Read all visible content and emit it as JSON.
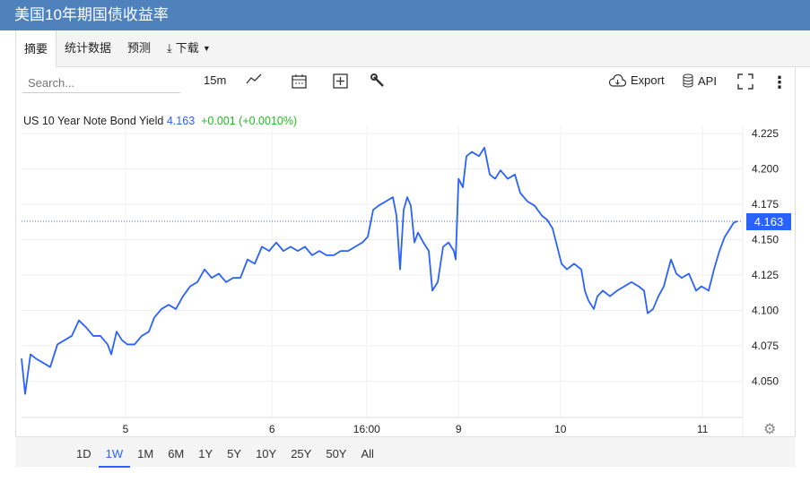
{
  "header": {
    "title": "美国10年期国债收益率"
  },
  "tabs": [
    {
      "label": "摘要"
    },
    {
      "label": "统计数据"
    },
    {
      "label": "预测"
    },
    {
      "label": "下载"
    }
  ],
  "toolbar": {
    "search_placeholder": "Search...",
    "interval": "15m",
    "export_label": "Export",
    "api_label": "API"
  },
  "legend": {
    "name": "US 10 Year Note Bond Yield",
    "value": "4.163",
    "change": "+0.001",
    "change_pct": "(+0.0010%)"
  },
  "ranges": [
    "1D",
    "1W",
    "1M",
    "6M",
    "1Y",
    "5Y",
    "10Y",
    "25Y",
    "50Y",
    "All"
  ],
  "active_range": "1W",
  "colors": {
    "header": "#4f81bd",
    "line": "#2962ff",
    "positive": "#22bb22"
  },
  "chart_data": {
    "type": "line",
    "title": "US 10 Year Note Bond Yield",
    "ylim": [
      4.025,
      4.24
    ],
    "xlim": [
      0,
      100.5
    ],
    "yticks": [
      4.05,
      4.075,
      4.1,
      4.125,
      4.15,
      4.175,
      4.2,
      4.225
    ],
    "ytick_labels": [
      "4.050",
      "4.075",
      "4.100",
      "4.125",
      "4.150",
      "4.175",
      "4.200",
      "4.225"
    ],
    "xticks": [
      14.5,
      34.9,
      48.1,
      60.9,
      75.1,
      94.9
    ],
    "xtick_labels": [
      "5",
      "6",
      "16:00",
      "9",
      "10",
      "11"
    ],
    "last_value": 4.163,
    "last_label": "4.163",
    "x": [
      0,
      0.5,
      1.25,
      2,
      3,
      4,
      5,
      6,
      7,
      8,
      9,
      10,
      11,
      12,
      12.5,
      13.25,
      14,
      14.75,
      15.75,
      16.75,
      17.75,
      18.5,
      19.5,
      20.5,
      21.5,
      22.5,
      23.5,
      24.5,
      25.5,
      26.5,
      27.5,
      28.5,
      29.5,
      30.5,
      31.5,
      32.5,
      33.5,
      34.5,
      35.5,
      36.5,
      37.5,
      38.5,
      39.5,
      40.5,
      41.5,
      42.5,
      43.5,
      44.5,
      45.5,
      46.5,
      47.5,
      48.25,
      49,
      49.75,
      50.75,
      51.75,
      52.25,
      52.75,
      53.25,
      53.75,
      54.25,
      54.75,
      55.25,
      56,
      56.75,
      57.25,
      58,
      58.75,
      59.5,
      60.25,
      60.5,
      60.9,
      61.5,
      62,
      62.75,
      63.75,
      64.5,
      65.25,
      66,
      66.75,
      67.75,
      68.75,
      69.5,
      70.5,
      71.5,
      72.5,
      73.25,
      74,
      74.5,
      75.25,
      76,
      77,
      78,
      78.5,
      79,
      79.75,
      80.25,
      81,
      82,
      83,
      84,
      85,
      86,
      86.75,
      87.25,
      88,
      88.75,
      89.5,
      90.5,
      91.25,
      92,
      93,
      94,
      94.75,
      95.75,
      96.5,
      97.25,
      98,
      98.75,
      99.25,
      99.75
    ],
    "y": [
      4.066,
      4.041,
      4.069,
      4.066,
      4.063,
      4.06,
      4.076,
      4.079,
      4.082,
      4.093,
      4.088,
      4.082,
      4.082,
      4.076,
      4.069,
      4.085,
      4.079,
      4.076,
      4.076,
      4.082,
      4.085,
      4.095,
      4.101,
      4.104,
      4.101,
      4.11,
      4.117,
      4.12,
      4.129,
      4.123,
      4.126,
      4.12,
      4.123,
      4.123,
      4.136,
      4.133,
      4.145,
      4.142,
      4.148,
      4.142,
      4.145,
      4.142,
      4.145,
      4.139,
      4.142,
      4.139,
      4.139,
      4.142,
      4.142,
      4.145,
      4.148,
      4.152,
      4.171,
      4.174,
      4.177,
      4.18,
      4.167,
      4.129,
      4.171,
      4.18,
      4.174,
      4.148,
      4.155,
      4.148,
      4.142,
      4.114,
      4.12,
      4.145,
      4.148,
      4.142,
      4.136,
      4.193,
      4.187,
      4.209,
      4.212,
      4.209,
      4.215,
      4.196,
      4.193,
      4.199,
      4.193,
      4.196,
      4.183,
      4.177,
      4.174,
      4.167,
      4.164,
      4.158,
      4.148,
      4.133,
      4.129,
      4.133,
      4.129,
      4.114,
      4.107,
      4.101,
      4.11,
      4.114,
      4.11,
      4.114,
      4.117,
      4.12,
      4.117,
      4.114,
      4.098,
      4.101,
      4.11,
      4.117,
      4.136,
      4.126,
      4.123,
      4.126,
      4.114,
      4.117,
      4.114,
      4.129,
      4.142,
      4.152,
      4.158,
      4.162,
      4.163
    ]
  }
}
